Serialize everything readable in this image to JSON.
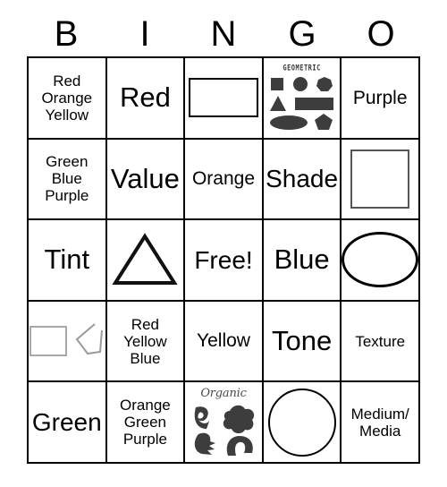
{
  "card": {
    "type": "bingo-card",
    "columns": 5,
    "rows": 5,
    "header": {
      "letters": [
        "B",
        "I",
        "N",
        "G",
        "O"
      ]
    },
    "colors": {
      "grid_line": "#000000",
      "text": "#000000",
      "shape_fill": "#3d3d3d",
      "light_gray_stroke": "#a8a8a8",
      "background": "#ffffff"
    },
    "cells": [
      [
        {
          "kind": "text",
          "name": "cell-b1",
          "text": "Red\nOrange\nYellow",
          "size": "sm"
        },
        {
          "kind": "text",
          "name": "cell-i1",
          "text": "Red",
          "size": "xl"
        },
        {
          "kind": "shape",
          "name": "cell-n1",
          "shape": "rectangle-outline",
          "text": ""
        },
        {
          "kind": "sample",
          "name": "cell-g1",
          "sample": "geometric",
          "title": "GEOMETRIC",
          "shapes": [
            "square",
            "circle",
            "heptagon",
            "triangle",
            "rectangle",
            "ellipse",
            "pentagon"
          ]
        },
        {
          "kind": "text",
          "name": "cell-o1",
          "text": "Purple",
          "size": "md"
        }
      ],
      [
        {
          "kind": "text",
          "name": "cell-b2",
          "text": "Green\nBlue\nPurple",
          "size": "sm"
        },
        {
          "kind": "text",
          "name": "cell-i2",
          "text": "Value",
          "size": "xl"
        },
        {
          "kind": "text",
          "name": "cell-n2",
          "text": "Orange",
          "size": "md"
        },
        {
          "kind": "text",
          "name": "cell-g2",
          "text": "Shade",
          "size": "lg"
        },
        {
          "kind": "shape",
          "name": "cell-o2",
          "shape": "square-outline",
          "text": ""
        }
      ],
      [
        {
          "kind": "text",
          "name": "cell-b3",
          "text": "Tint",
          "size": "xl"
        },
        {
          "kind": "shape",
          "name": "cell-i3",
          "shape": "triangle-outline",
          "text": ""
        },
        {
          "kind": "text",
          "name": "cell-n3",
          "text": "Free!",
          "size": "lg"
        },
        {
          "kind": "text",
          "name": "cell-g3",
          "text": "Blue",
          "size": "xl"
        },
        {
          "kind": "shape",
          "name": "cell-o3",
          "shape": "ellipse-outline",
          "text": ""
        }
      ],
      [
        {
          "kind": "shape",
          "name": "cell-b4",
          "shape": "gray-rect-and-open-polygon",
          "text": ""
        },
        {
          "kind": "text",
          "name": "cell-i4",
          "text": "Red\nYellow\nBlue",
          "size": "sm"
        },
        {
          "kind": "text",
          "name": "cell-n4",
          "text": "Yellow",
          "size": "md"
        },
        {
          "kind": "text",
          "name": "cell-g4",
          "text": "Tone",
          "size": "xl"
        },
        {
          "kind": "text",
          "name": "cell-o4",
          "text": "Texture",
          "size": "sm"
        }
      ],
      [
        {
          "kind": "text",
          "name": "cell-b5",
          "text": "Green",
          "size": "lg"
        },
        {
          "kind": "text",
          "name": "cell-i5",
          "text": "Orange\nGreen\nPurple",
          "size": "sm"
        },
        {
          "kind": "sample",
          "name": "cell-n5",
          "sample": "organic",
          "title": "Organic",
          "shapes": [
            "blob-hook",
            "blob-cloud",
            "blob-spiky",
            "blob-arc"
          ]
        },
        {
          "kind": "shape",
          "name": "cell-g5",
          "shape": "circle-outline",
          "text": ""
        },
        {
          "kind": "text",
          "name": "cell-o5",
          "text": "Medium/\nMedia",
          "size": "sm"
        }
      ]
    ]
  }
}
